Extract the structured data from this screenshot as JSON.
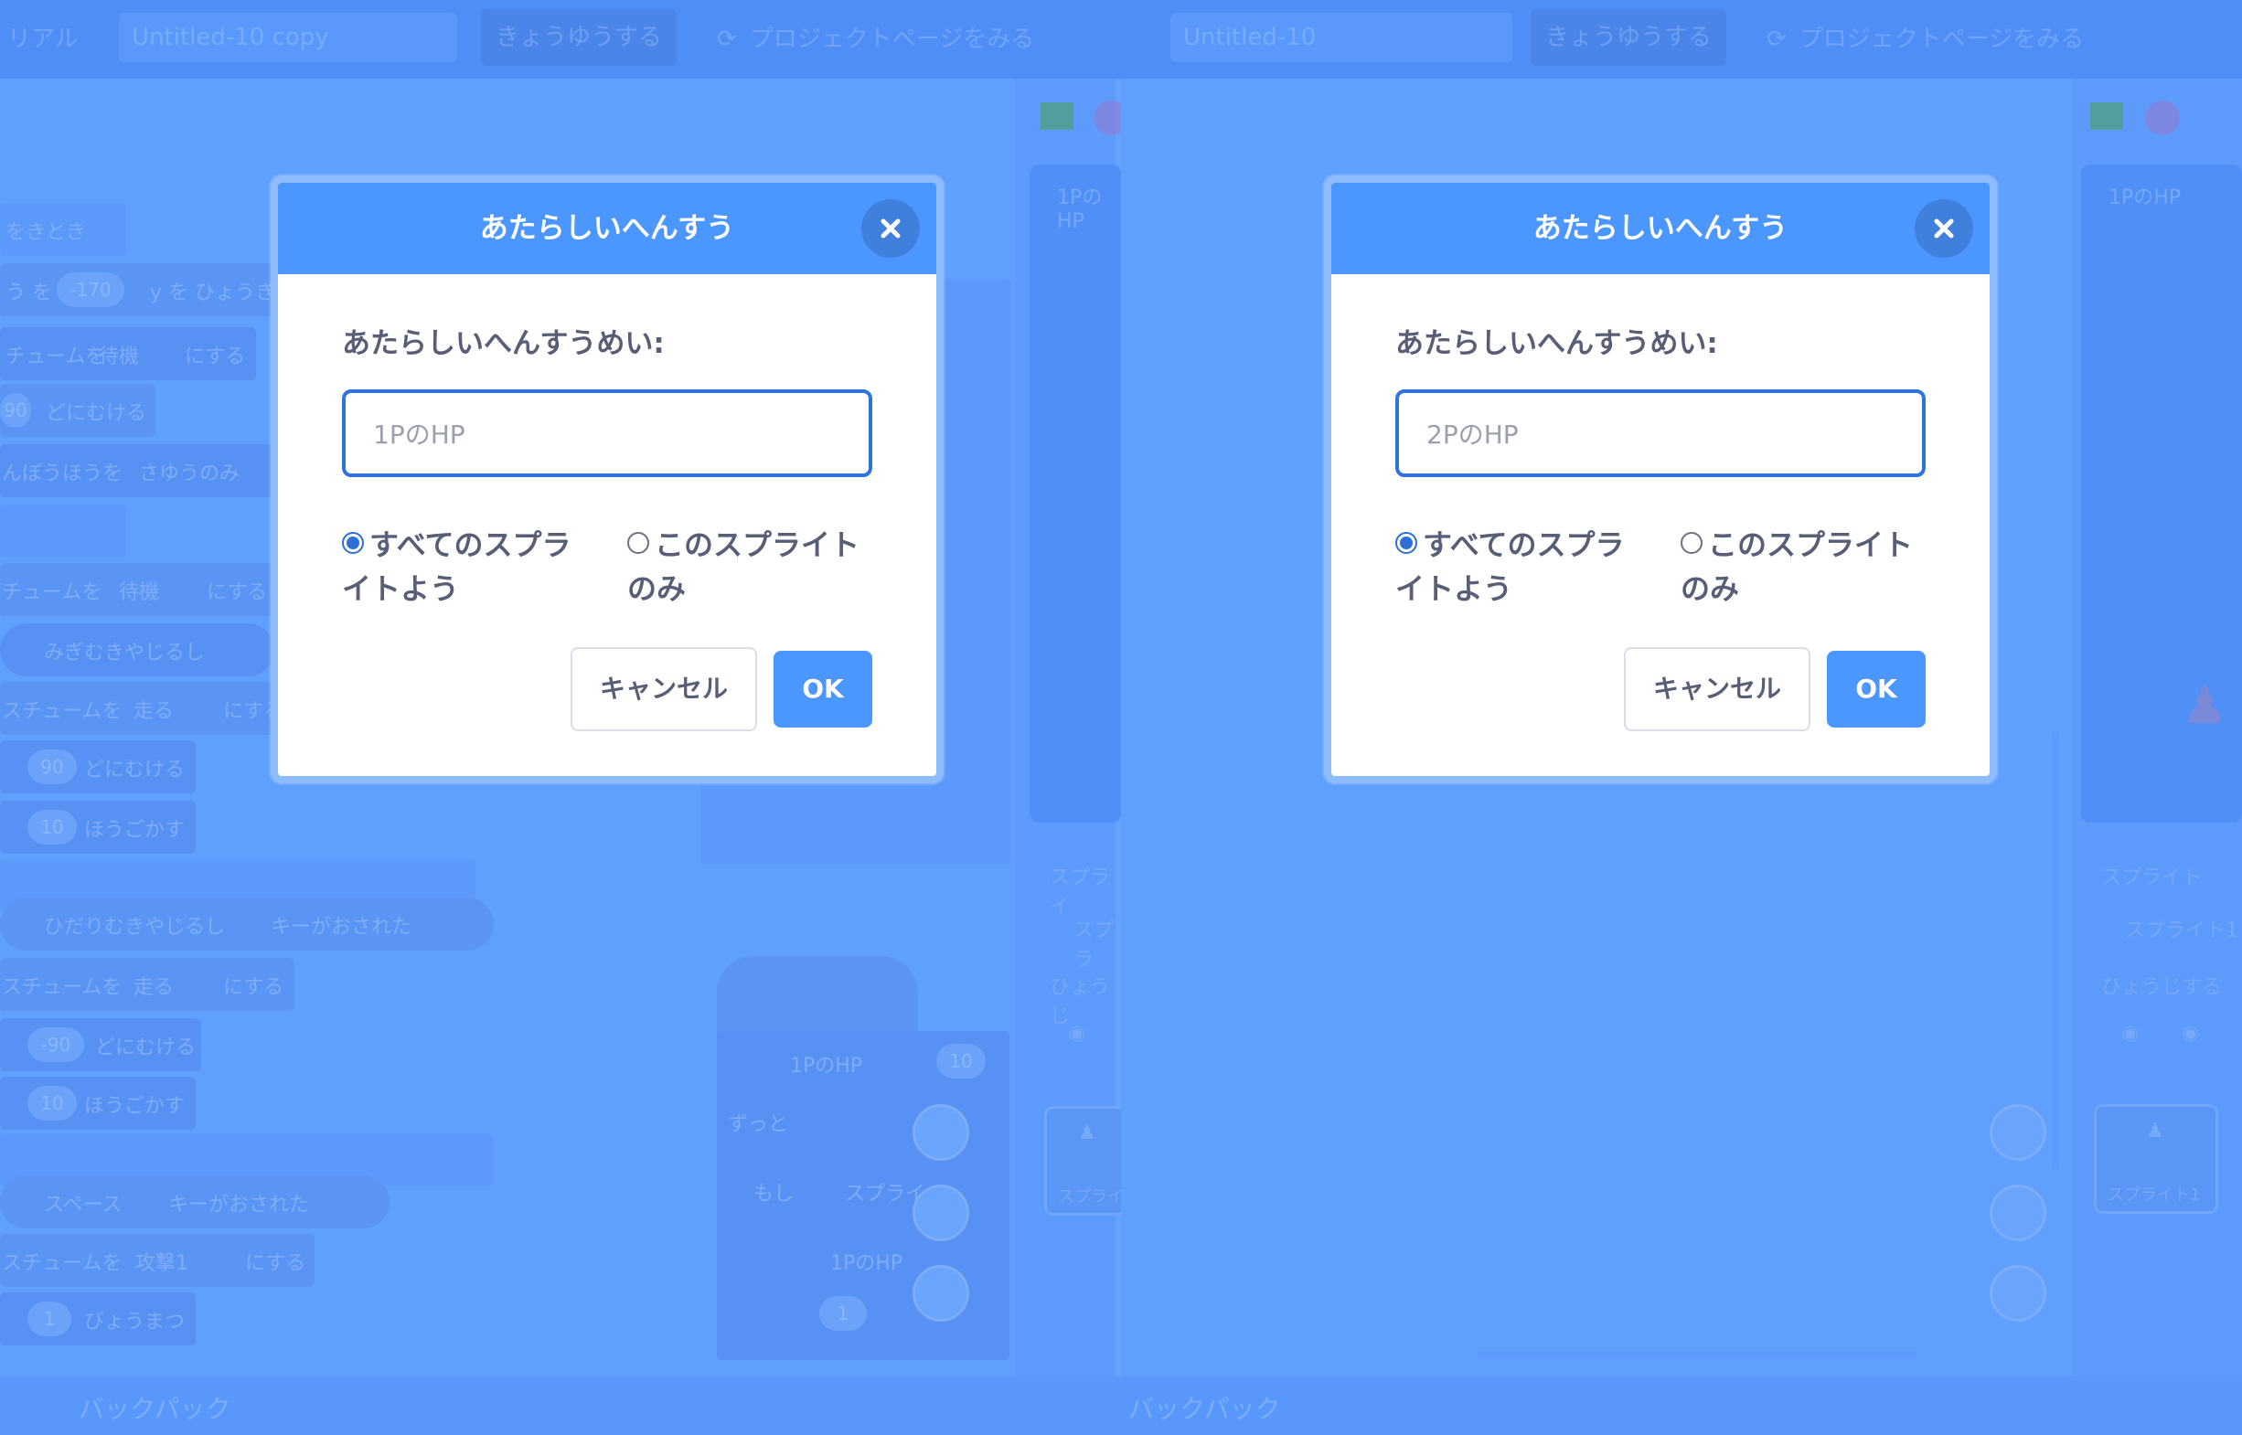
{
  "menubar": {
    "tutorial_label": "リアル",
    "share_label": "きょうゆうする",
    "project_page_label": "プロジェクトページをみる"
  },
  "panels": [
    {
      "project_title": "Untitled-10 copy",
      "stage_sprite_label": "1PのHP",
      "sprite_section_label": "スプライ",
      "sprite_name_label": "スプラ",
      "show_label": "ひょうじ",
      "sprite_thumb_label": "スプライ",
      "script_texts": [
        "をきとき",
        "う を",
        "-170",
        "y を ひょうき",
        "チュームを",
        "待機",
        "にする",
        "90",
        "どにむける",
        "んぼうほうを",
        "さゆうのみ",
        "チュームを",
        "待機",
        "にする",
        "みぎむきやじるし",
        "スチュームを",
        "走る",
        "にする",
        "90",
        "どにむける",
        "10",
        "ほうごかす",
        "ひだりむきやじるし",
        "キーがおされた",
        "スチュームを",
        "走る",
        "にする",
        "-90",
        "どにむける",
        "10",
        "ほうごかす",
        "スペース",
        "キーがおされた",
        "スチュームを",
        "攻撃1",
        "にする",
        "1",
        "びょうまつ"
      ],
      "right_script_texts": [
        "1PのHP",
        "10",
        "ずっと",
        "もし",
        "スプライ",
        "1PのHP",
        "1"
      ],
      "dialog": {
        "title": "あたらしいへんすう",
        "field_label": "あたらしいへんすうめい:",
        "input_value": "1PのHP",
        "option_all_sprites": "すべてのスプライトよう",
        "option_this_sprite": "このスプライトのみ",
        "selected_option": "all_sprites",
        "cancel_label": "キャンセル",
        "ok_label": "OK"
      }
    },
    {
      "project_title": "Untitled-10",
      "stage_sprite_label": "1PのHP",
      "sprite_section_label": "スプライト",
      "sprite_name_label": "スプライト1",
      "show_label": "ひょうじする",
      "sprite_thumb_label": "スプライト1",
      "dialog": {
        "title": "あたらしいへんすう",
        "field_label": "あたらしいへんすうめい:",
        "input_value": "2PのHP",
        "option_all_sprites": "すべてのスプライトよう",
        "option_this_sprite": "このスプライトのみ",
        "selected_option": "all_sprites",
        "cancel_label": "キャンセル",
        "ok_label": "OK"
      }
    }
  ],
  "backpack_label": "バックパック",
  "colors": {
    "modal_header": "#4c97ff",
    "input_border": "#2e74dd",
    "overlay_tint": "#64a3ff",
    "text_dark": "#575e75"
  },
  "icons": [
    "close-icon",
    "green-flag-icon",
    "stop-icon",
    "zoom-in-icon",
    "zoom-out-icon",
    "zoom-reset-icon",
    "eye-icon",
    "sprite-icon"
  ]
}
